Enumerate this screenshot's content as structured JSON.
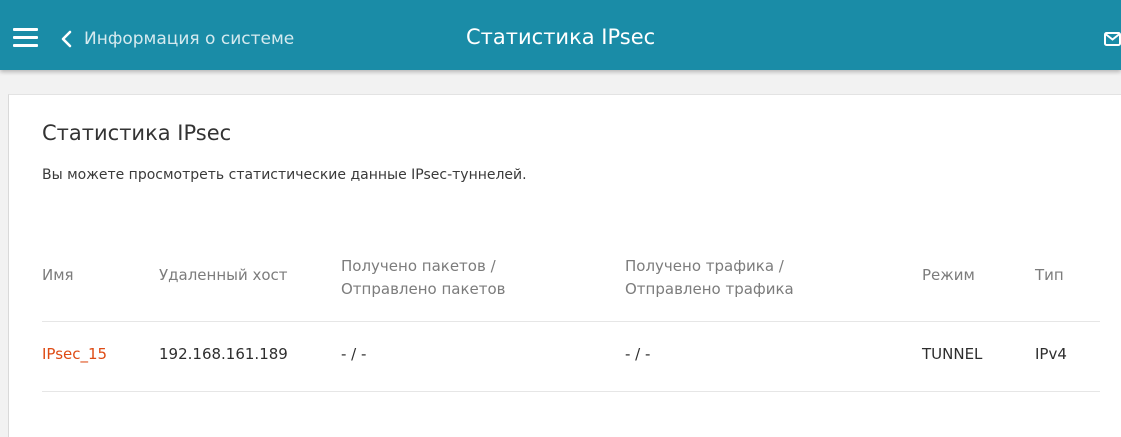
{
  "header": {
    "back_label": "Информация о системе",
    "title": "Статистика IPsec",
    "colors": {
      "bar": "#1a8ca7",
      "text": "#ffffff"
    },
    "icons": {
      "menu": "hamburger-menu-icon",
      "back": "chevron-left-icon",
      "mail": "mail-icon"
    }
  },
  "page": {
    "title": "Статистика IPsec",
    "description": "Вы можете просмотреть статистические данные IPsec-туннелей."
  },
  "table": {
    "columns": {
      "name": "Имя",
      "remote_host": "Удаленный хост",
      "packets_line1": "Получено пакетов /",
      "packets_line2": "Отправлено пакетов",
      "traffic_line1": "Получено трафика /",
      "traffic_line2": "Отправлено трафика",
      "mode": "Режим",
      "type": "Тип"
    },
    "rows": [
      {
        "name": "IPsec_15",
        "remote_host": "192.168.161.189",
        "packets": "- / -",
        "traffic": "- / -",
        "mode": "TUNNEL",
        "type": "IPv4"
      }
    ],
    "link_color": "#de4b14"
  }
}
